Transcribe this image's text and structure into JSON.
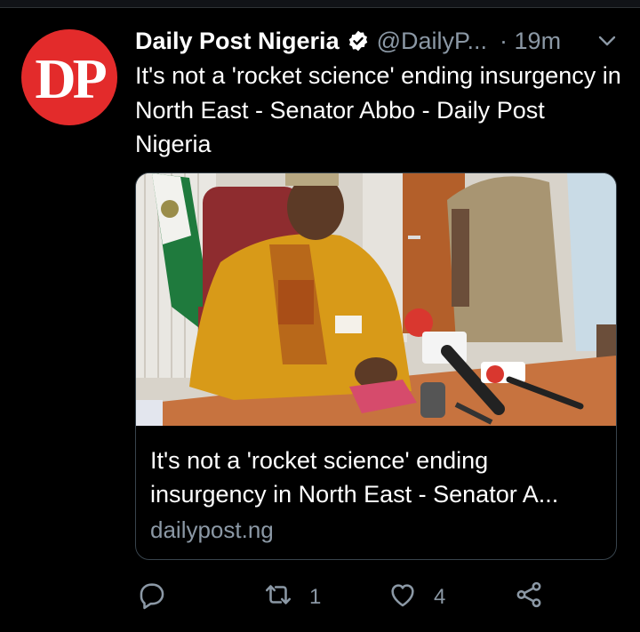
{
  "tweet": {
    "author": {
      "name": "Daily Post Nigeria",
      "handle": "@DailyP...",
      "avatar_text": "DP",
      "avatar_color": "#e32b2b",
      "verified": true
    },
    "time": "· 19m",
    "text": "It's not a 'rocket science' ending insurgency in North East - Senator Abbo - Daily Post Nigeria",
    "card": {
      "title": "It's not a 'rocket science' ending insurgency in North East - Senator A...",
      "domain": "dailypost.ng"
    },
    "actions": {
      "reply_count": "",
      "retweet_count": "1",
      "like_count": "4"
    }
  },
  "theme": {
    "background": "#000000",
    "text": "#ffffff",
    "secondary_text": "#8b98a5",
    "border": "#38444d"
  },
  "icons": [
    "verified-badge-icon",
    "chevron-down-icon",
    "reply-icon",
    "retweet-icon",
    "like-icon",
    "share-icon"
  ]
}
